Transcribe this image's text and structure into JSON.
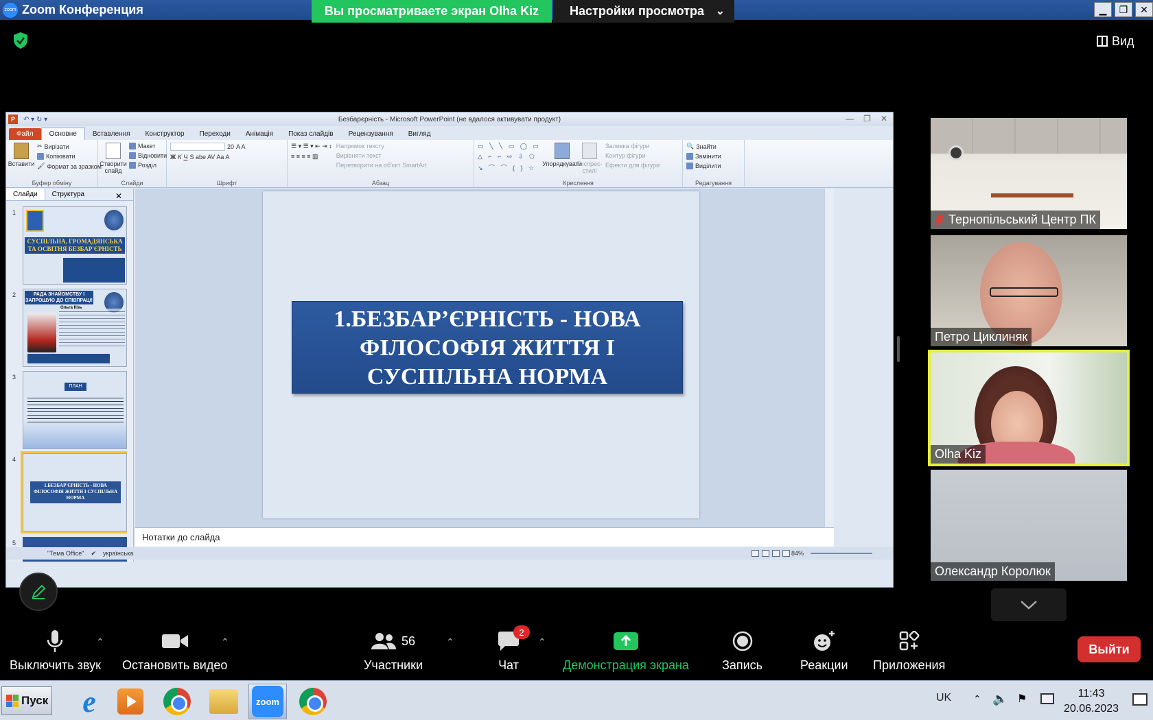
{
  "zoom": {
    "app_title": "Zoom Конференция",
    "logo_text": "zoom",
    "sharing_banner": "Вы просматриваете экран Olha Kiz",
    "view_settings": "Настройки просмотра",
    "view_button": "Вид"
  },
  "ppt": {
    "window_title": "Безбарєрність - Microsoft PowerPoint (не вдалося активувати продукт)",
    "tabs": [
      "Файл",
      "Основне",
      "Вставлення",
      "Конструктор",
      "Переходи",
      "Анімація",
      "Показ слайдів",
      "Рецензування",
      "Вигляд"
    ],
    "ribbon": {
      "paste": "Вставити",
      "cut": "Вирізати",
      "copy": "Копіювати",
      "format_painter": "Формат за зразком",
      "clipboard_group": "Буфер обміну",
      "new_slide": "Створити слайд",
      "layout": "Макет",
      "reset": "Відновити",
      "section": "Розділ",
      "slides_group": "Слайди",
      "font_size": "20",
      "font_group": "Шрифт",
      "text_direction": "Напрямок тексту",
      "align_text": "Вирівняти текст",
      "smartart": "Перетворити на об'єкт SmartArt",
      "paragraph_group": "Абзац",
      "arrange": "Упорядкувати",
      "quick_styles": "Експрес-стилі",
      "shape_fill": "Заливка фігури",
      "shape_outline": "Контур фігури",
      "shape_effects": "Ефекти для фігури",
      "drawing_group": "Креслення",
      "find": "Знайти",
      "replace": "Замінити",
      "select": "Виділити",
      "editing_group": "Редагування"
    },
    "pane_tabs": [
      "Слайди",
      "Структура"
    ],
    "thumbnails": [
      {
        "num": "1",
        "banner": "СУСПІЛЬНА, ГРОМАДЯНСЬКА ТА ОСВІТНЯ БЕЗБАР'ЄРНІСТЬ"
      },
      {
        "num": "2",
        "header": "РАДА ЗНАЙОМСТВУ І ЗАПРОШУЮ ДО СПІВПРАЦІ!",
        "name": "Ольга Кізь"
      },
      {
        "num": "3",
        "title": "ПЛАН"
      },
      {
        "num": "4",
        "title": "1.БЕЗБАР'ЄРНІСТЬ - НОВА ФІЛОСОФІЯ ЖИТТЯ І СУСПІЛЬНА НОРМА"
      },
      {
        "num": "5"
      }
    ],
    "slide_title": "1.БЕЗБАР’ЄРНІСТЬ - НОВА\nФІЛОСОФІЯ ЖИТТЯ  І\nСУСПІЛЬНА НОРМА",
    "notes_placeholder": "Нотатки до слайда",
    "status_theme": "\"Тема Office\"",
    "status_language": "українська",
    "status_zoom": "84%"
  },
  "participants": [
    {
      "name": "Тернопільський Центр ПК",
      "muted": true
    },
    {
      "name": "Петро Циклиняк",
      "muted": false
    },
    {
      "name": "Olha Kiz",
      "muted": false,
      "speaking": true
    },
    {
      "name": "Олександр Королюк",
      "muted": false
    }
  ],
  "toolbar": {
    "mute": "Выключить звук",
    "stop_video": "Остановить видео",
    "participants_count": "56",
    "participants": "Участники",
    "chat": "Чат",
    "chat_badge": "2",
    "share": "Демонстрация экрана",
    "record": "Запись",
    "reactions": "Реакции",
    "apps": "Приложения",
    "leave": "Выйти"
  },
  "taskbar": {
    "start": "Пуск",
    "language": "UK",
    "time": "11:43",
    "date": "20.06.2023",
    "zoom_icon_text": "zoom"
  },
  "colors": {
    "share_green": "#22c55e",
    "leave_red": "#d32f2f",
    "active_speaker": "#e6f03a",
    "slide_blue": "#2b5597"
  }
}
